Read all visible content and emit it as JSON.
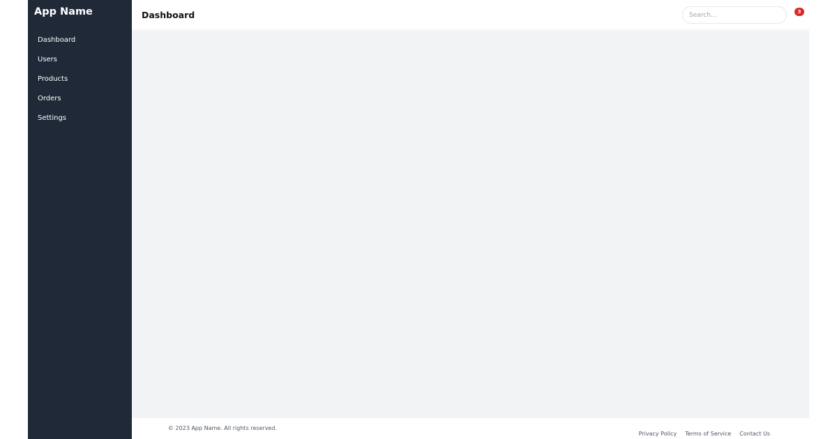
{
  "app": {
    "name": "App Name"
  },
  "sidebar": {
    "items": [
      {
        "label": "Dashboard"
      },
      {
        "label": "Users"
      },
      {
        "label": "Products"
      },
      {
        "label": "Orders"
      },
      {
        "label": "Settings"
      }
    ]
  },
  "header": {
    "title": "Dashboard",
    "search_placeholder": "Search...",
    "notification_count": "3"
  },
  "footer": {
    "copyright": "© 2023 App Name. All rights reserved.",
    "links": [
      {
        "label": "Privacy Policy"
      },
      {
        "label": "Terms of Service"
      },
      {
        "label": "Contact Us"
      }
    ]
  },
  "colors": {
    "sidebar_bg": "#1f2937",
    "content_bg": "#f2f3f5",
    "badge": "#dc2626"
  }
}
